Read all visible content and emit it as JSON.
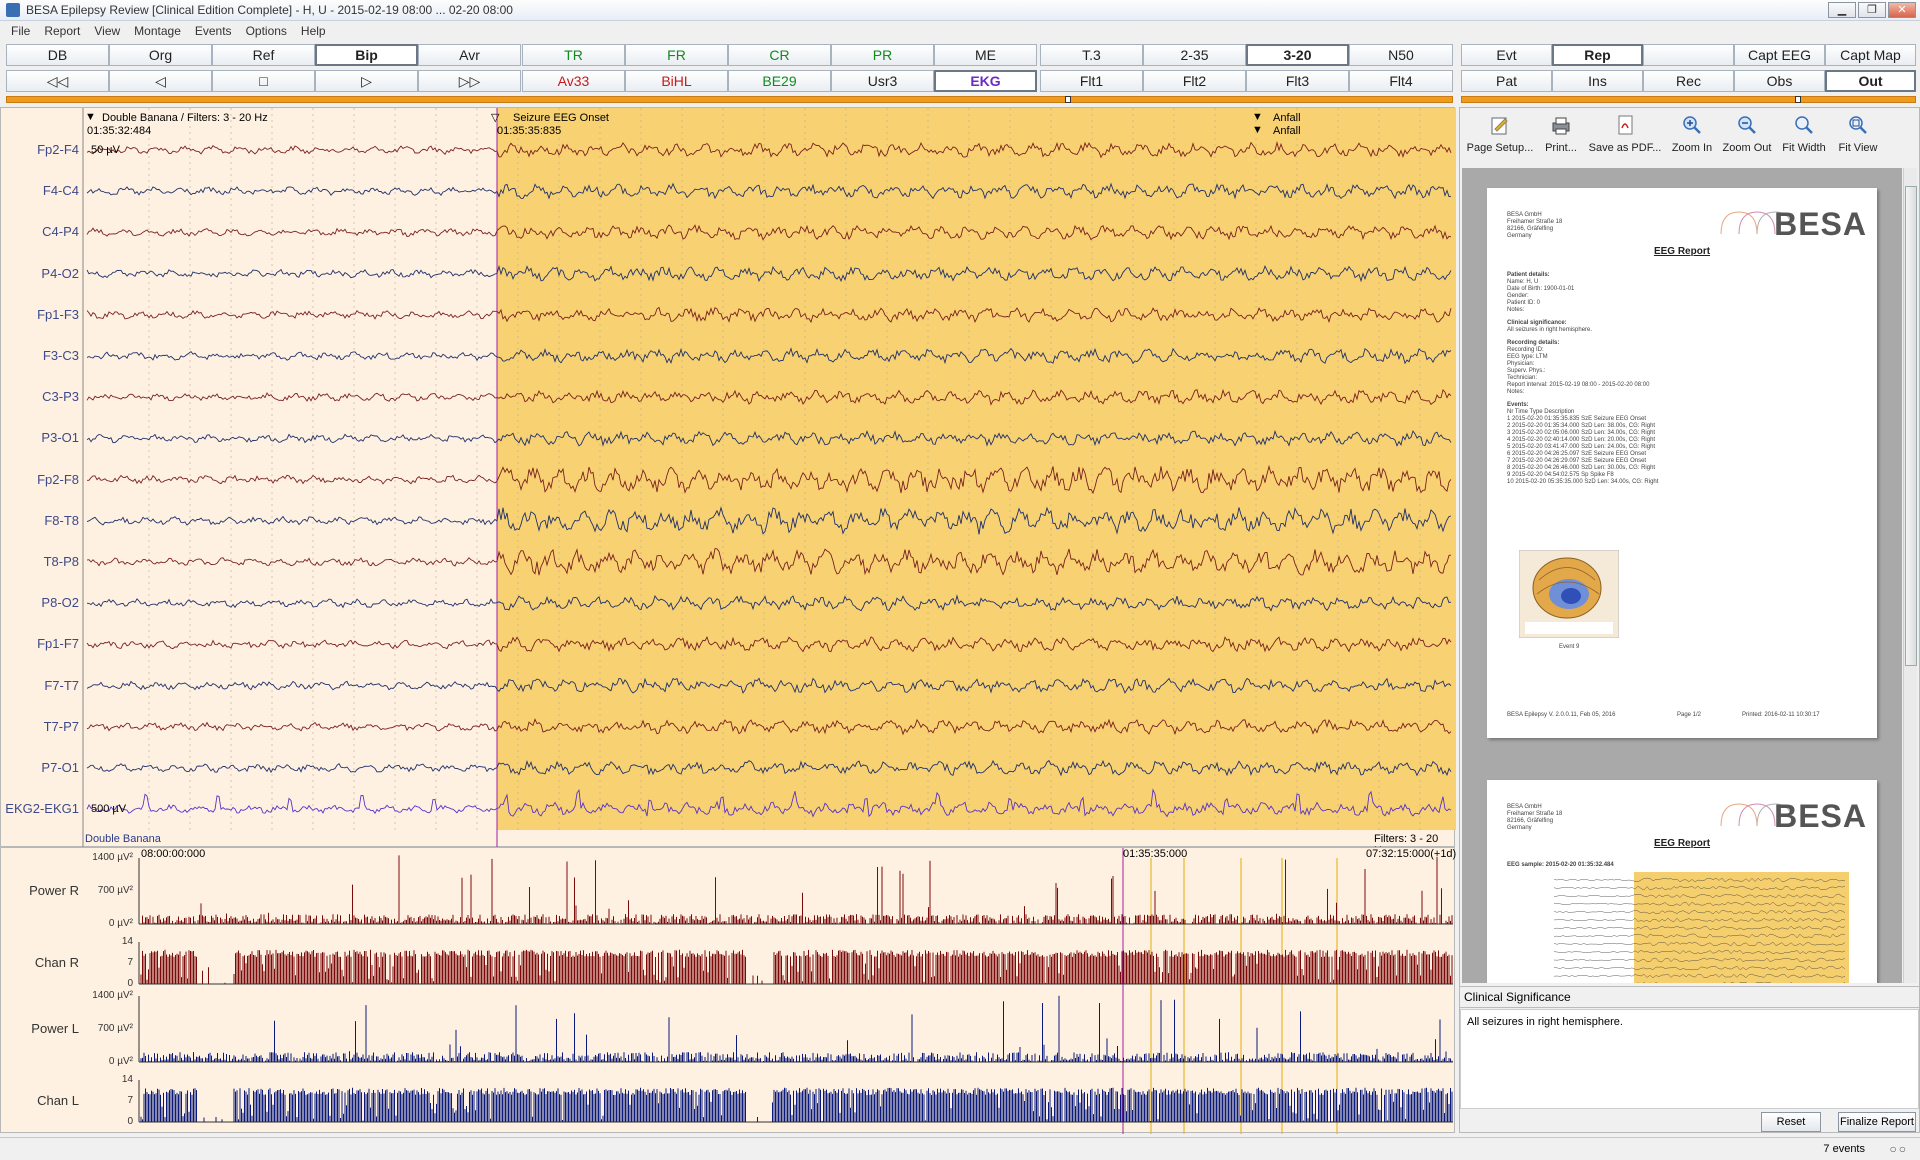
{
  "window": {
    "title": "BESA Epilepsy Review [Clinical Edition Complete]  -  H, U  -  2015-02-19 08:00 ... 02-20 08:00",
    "min": "▁",
    "max": "❐",
    "close": "✕"
  },
  "menu": [
    "File",
    "Report",
    "View",
    "Montage",
    "Events",
    "Options",
    "Help"
  ],
  "toolbar": {
    "row1": [
      "DB",
      "Org",
      "Ref",
      "Bip",
      "Avr",
      "TR",
      "FR",
      "CR",
      "PR",
      "ME",
      "T.3",
      "2-35",
      "3-20",
      "N50",
      "Evt",
      "Rep",
      "",
      "Capt EEG",
      "Capt Map"
    ],
    "row2": [
      "◁◁",
      "◁",
      "□",
      "▷",
      "▷▷",
      "Av33",
      "BiHL",
      "BE29",
      "Usr3",
      "EKG",
      "Flt1",
      "Flt2",
      "Flt3",
      "Flt4",
      "Pat",
      "Ins",
      "Rec",
      "Obs",
      "Out"
    ]
  },
  "eeg": {
    "montage_header": "Double Banana / Filters: 3 - 20 Hz",
    "start_time": "01:35:32:484",
    "onset_label": "Seizure EEG Onset",
    "onset_time": "01:35:35:835",
    "event1": "Anfall",
    "event2": "Anfall",
    "scale_top": "50 µV",
    "scale_ekg": "500 µV",
    "montage_footer": "Double Banana",
    "filters_footer": "Filters: 3 - 20 Hz",
    "channels": [
      "Fp2-F4",
      "F4-C4",
      "C4-P4",
      "P4-O2",
      "Fp1-F3",
      "F3-C3",
      "C3-P3",
      "P3-O1",
      "Fp2-F8",
      "F8-T8",
      "T8-P8",
      "P8-O2",
      "Fp1-F7",
      "F7-T7",
      "T7-P7",
      "P7-O1",
      "EKG2-EKG1"
    ]
  },
  "trend": {
    "t_start": "08:00:00:000",
    "t_mid": "01:35:35:000",
    "t_end": "07:32:15:000(+1d)",
    "plots": [
      {
        "label": "Power R",
        "ticks": [
          "1400 µV²",
          "700 µV²",
          "0 µV²"
        ]
      },
      {
        "label": "Chan R",
        "ticks": [
          "14",
          "7",
          "0"
        ]
      },
      {
        "label": "Power L",
        "ticks": [
          "1400 µV²",
          "700 µV²",
          "0 µV²"
        ]
      },
      {
        "label": "Chan L",
        "ticks": [
          "14",
          "7",
          "0"
        ]
      }
    ]
  },
  "report_tools": [
    "Page Setup...",
    "Print...",
    "Save as PDF...",
    "Zoom In",
    "Zoom Out",
    "Fit Width",
    "Fit View"
  ],
  "report": {
    "logo": "BESA",
    "title": "EEG Report",
    "address": [
      "BESA GmbH",
      "Freihamer Straße 18",
      "82166, Gräfelfing",
      "Germany"
    ],
    "patient_header": "Patient details:",
    "patient": [
      "Name:          H, U",
      "Date of Birth:    1900-01-01",
      "Gender:",
      "Patient ID:       0",
      "Notes:"
    ],
    "clin_header": "Clinical significance:",
    "clin_text": "All seizures in right hemisphere.",
    "rec_header": "Recording details:",
    "rec": [
      "Recording ID:",
      "EEG type:            LTM",
      "Physician:",
      "Superv. Phys.:",
      "Technician:",
      "Report interval:    2015-02-19 08:00 - 2015-02-20 08:00",
      "Notes:"
    ],
    "events_header": "Events:",
    "events_cols": "Nr      Time                          Type     Description",
    "events": [
      "1    2015-02-20 01:35:35.835   SzE    Seizure EEG Onset",
      "2    2015-02-20 01:35:34.000   SzD    Len: 38.00s, CG: Right",
      "3    2015-02-20 02:05:06.000   SzD    Len: 34.00s, CG: Right",
      "4    2015-02-20 02:40:14.000   SzD    Len: 20.00s, CG: Right",
      "5    2015-02-20 03:41:47.000   SzD    Len: 24.00s, CG: Right",
      "6    2015-02-20 04:26:25.097   SzE    Seizure EEG Onset",
      "7    2015-02-20 04:26:29.097   SzE    Seizure EEG Onset",
      "8    2015-02-20 04:26:46.000   SzD    Len: 30.00s, CG: Right",
      "9    2015-02-20 04:54:02.575   Sp     Spike F8",
      "10   2015-02-20 05:35:35.000   SzD    Len: 34.00s, CG: Right"
    ],
    "map_caption": "Event 9",
    "footer_left": "BESA Epilepsy V. 2.0.0.11, Feb 05, 2016",
    "footer_mid": "Page 1/2",
    "footer_right": "Printed: 2016-02-11 10:30:17",
    "page2_sample": "EEG sample: 2015-02-20 01:35:32.484"
  },
  "clinical": {
    "header": "Clinical Significance",
    "text": "All seizures in right hemisphere.",
    "reset": "Reset",
    "finalize": "Finalize Report"
  },
  "status": {
    "events": "7 events",
    "circles": "○○"
  }
}
